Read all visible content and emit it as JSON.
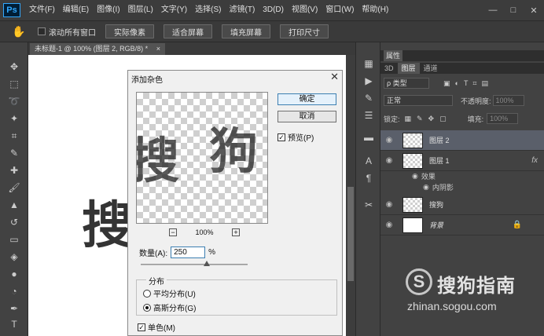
{
  "app": {
    "logo": "Ps"
  },
  "menu": [
    "文件(F)",
    "编辑(E)",
    "图像(I)",
    "图层(L)",
    "文字(Y)",
    "选择(S)",
    "滤镜(T)",
    "3D(D)",
    "视图(V)",
    "窗口(W)",
    "帮助(H)"
  ],
  "window_controls": {
    "minimize": "—",
    "restore": "□",
    "close": "✕"
  },
  "options_bar": {
    "scroll_all_windows": "滚动所有窗口",
    "actual_pixels": "实际像素",
    "fit_screen": "适合屏幕",
    "fill_screen": "填充屏幕",
    "print_size": "打印尺寸"
  },
  "document": {
    "tab_title": "未标题-1 @ 100% (图层 2, RGB/8) *",
    "tab_close": "×",
    "canvas_text": "搜狗"
  },
  "dialog": {
    "title": "添加杂色",
    "close": "✕",
    "ok": "确定",
    "cancel": "取消",
    "preview_label": "预览(P)",
    "preview_checked": true,
    "preview_glyphs": [
      "搜",
      "狗"
    ],
    "zoom_minus": "−",
    "zoom_level": "100%",
    "zoom_plus": "+",
    "amount_label": "数量(A):",
    "amount_value": "250",
    "amount_unit": "%",
    "amount_slider_fraction": 0.6,
    "distribution_label": "分布",
    "uniform": "平均分布(U)",
    "gaussian": "高斯分布(G)",
    "distribution_selected": "gaussian",
    "monochromatic": "单色(M)",
    "monochromatic_checked": true
  },
  "panels": {
    "properties_tab": "属性",
    "tabs": [
      "3D",
      "图层",
      "通道"
    ],
    "active_tab": "图层",
    "filter_kind": "ρ 类型",
    "blend_mode": "正常",
    "opacity_label": "不透明度:",
    "opacity_value": "100%",
    "lock_label": "锁定:",
    "fill_label": "填充:",
    "fill_value": "100%",
    "layers": [
      {
        "name": "图层 2",
        "selected": true,
        "thumb": "transparent"
      },
      {
        "name": "图层 1",
        "selected": false,
        "thumb": "transparent",
        "fx": "fx"
      },
      {
        "name": "搜狗",
        "selected": false,
        "thumb": "transparent"
      },
      {
        "name": "背景",
        "selected": false,
        "thumb": "white",
        "locked": true
      }
    ],
    "effects_label": "效果",
    "inner_shadow": "内阴影"
  },
  "watermark": {
    "logo": "S",
    "name": "搜狗指南",
    "url": "zhinan.sogou.com"
  }
}
